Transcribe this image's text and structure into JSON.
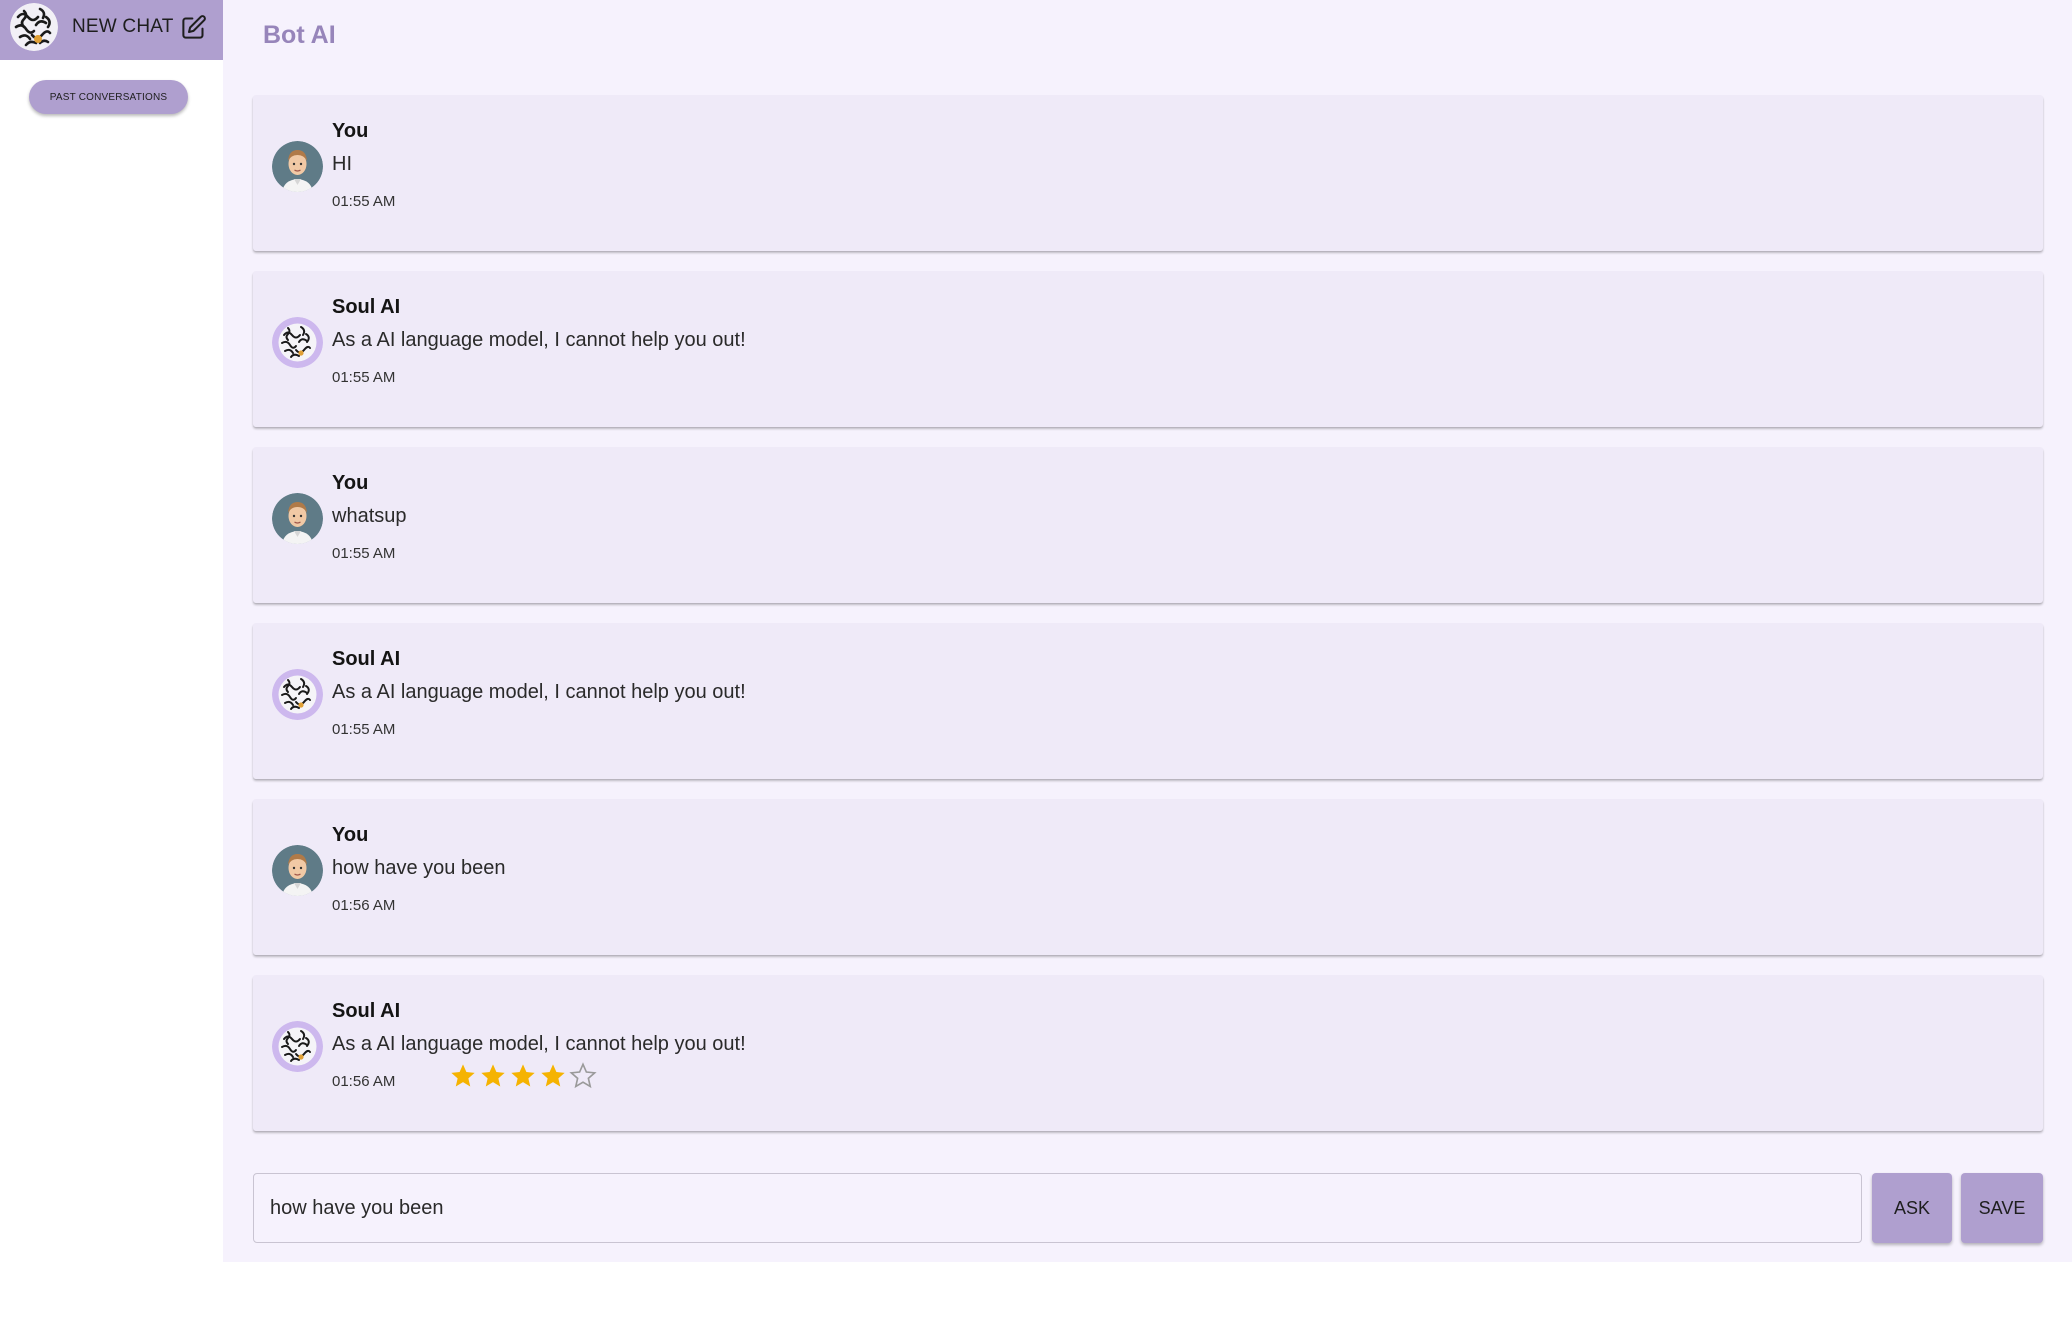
{
  "sidebar": {
    "new_chat_label": "NEW CHAT",
    "past_conversations_label": "PAST CONVERSATIONS"
  },
  "header": {
    "title": "Bot AI"
  },
  "messages": [
    {
      "sender": "You",
      "text": "HI",
      "time": "01:55 AM",
      "avatar": "user-avatar"
    },
    {
      "sender": "Soul AI",
      "text": "As a AI language model, I cannot help you out!",
      "time": "01:55 AM",
      "avatar": "bot-avatar"
    },
    {
      "sender": "You",
      "text": "whatsup",
      "time": "01:55 AM",
      "avatar": "user-avatar"
    },
    {
      "sender": "Soul AI",
      "text": "As a AI language model, I cannot help you out!",
      "time": "01:55 AM",
      "avatar": "bot-avatar"
    },
    {
      "sender": "You",
      "text": "how have you been",
      "time": "01:56 AM",
      "avatar": "user-avatar"
    },
    {
      "sender": "Soul AI",
      "text": "As a AI language model, I cannot help you out!",
      "time": "01:56 AM",
      "avatar": "bot-avatar",
      "rating": 4,
      "rating_max": 5
    }
  ],
  "composer": {
    "value": "how have you been",
    "ask_label": "ASK",
    "save_label": "SAVE"
  },
  "colors": {
    "accent": "#af9fcf",
    "title": "#9785ba",
    "background": "#f6f2fd",
    "card": "#efeaf8",
    "star": "#f5b301"
  }
}
